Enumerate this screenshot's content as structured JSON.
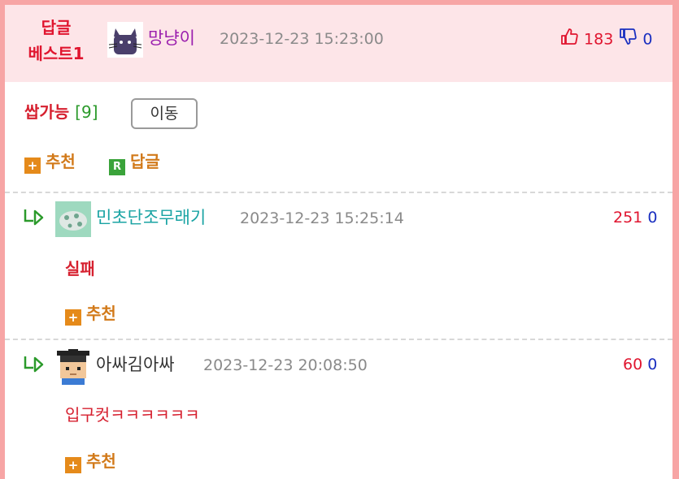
{
  "best": {
    "badge_line1": "답글",
    "badge_line2": "베스트1",
    "username": "망냥이",
    "timestamp": "2023-12-23 15:23:00",
    "up": "183",
    "down": "0"
  },
  "comment_box": {
    "title": "쌉가능",
    "count": "[9]",
    "move_label": "이동",
    "recommend_label": "추천",
    "reply_label": "답글",
    "reply_box_glyph": "R",
    "plus_glyph": "+"
  },
  "replies": [
    {
      "username": "민초단조무래기",
      "timestamp": "2023-12-23 15:25:14",
      "up": "251",
      "down": "0",
      "text": "실패",
      "recommend_label": "추천"
    },
    {
      "username": "아싸김아싸",
      "timestamp": "2023-12-23 20:08:50",
      "up": "60",
      "down": "0",
      "text": "입구컷ㅋㅋㅋㅋㅋㅋ",
      "recommend_label": "추천"
    }
  ],
  "colors": {
    "frame": "#f7a5a5",
    "header_bg": "#fde5e8",
    "accent_red": "#e0152f",
    "down_blue": "#1a2fc0",
    "green": "#2b9a2b",
    "orange": "#e58a1a",
    "name_purple": "#9b1fae",
    "name_teal": "#19a3a3"
  }
}
